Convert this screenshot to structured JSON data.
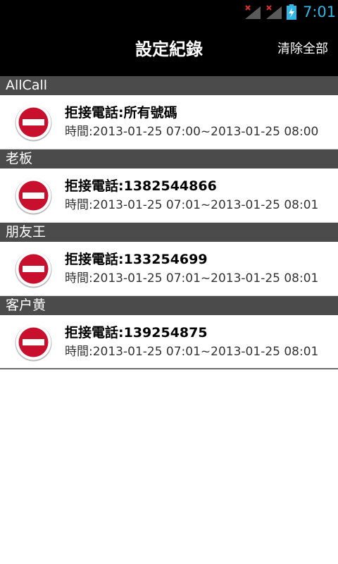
{
  "status_bar": {
    "time": "7:01",
    "icons": [
      "signal-no-service-icon",
      "signal-no-service-icon",
      "battery-charging-icon"
    ]
  },
  "action_bar": {
    "title": "設定紀錄",
    "clear_all_label": "清除全部"
  },
  "groups": [
    {
      "name": "AllCall",
      "record": {
        "title": "拒接電話:所有號碼",
        "time": "時間:2013-01-25 07:00~2013-01-25 08:00"
      }
    },
    {
      "name": "老板",
      "record": {
        "title": "拒接電話:1382544866",
        "time": "時間:2013-01-25 07:01~2013-01-25 08:01"
      }
    },
    {
      "name": "朋友王",
      "record": {
        "title": "拒接電話:133254699",
        "time": "時間:2013-01-25 07:01~2013-01-25 08:01"
      }
    },
    {
      "name": "客户黄",
      "record": {
        "title": "拒接電話:139254875",
        "time": "時間:2013-01-25 07:01~2013-01-25 08:01"
      }
    }
  ],
  "colors": {
    "accent": "#33b5e5",
    "header_bg": "#4b4b4b",
    "delete_red": "#c8102e"
  }
}
